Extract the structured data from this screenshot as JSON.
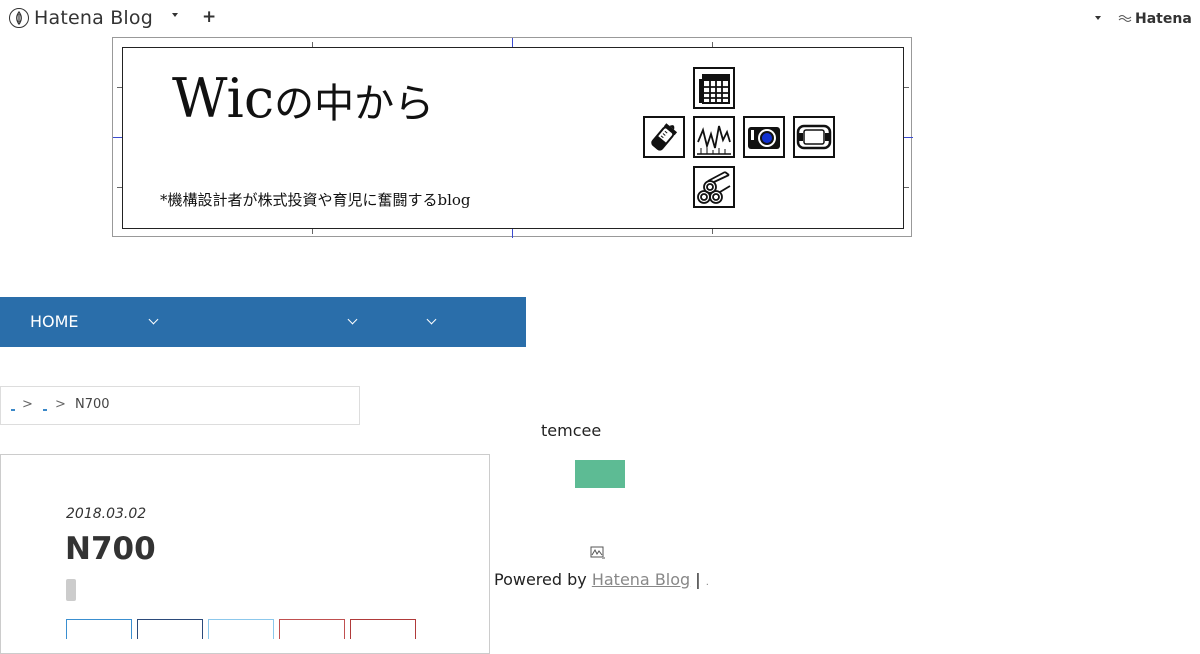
{
  "topbar": {
    "brand_label": "Hatena Blog",
    "plus_label": "+",
    "right_brand_label": "Hatena"
  },
  "banner": {
    "title_latin": "Wic",
    "title_japanese": "の中から",
    "subtitle": "*機構設計者が株式投資や育児に奮闘するblog",
    "icons": [
      "calendar-grid-icon",
      "baby-bottle-icon",
      "stock-chart-icon",
      "camera-icon",
      "game-console-icon",
      "logs-icon"
    ]
  },
  "nav": {
    "home_label": "HOME"
  },
  "breadcrumb": {
    "separator": ">",
    "current": "N700"
  },
  "article": {
    "date": "2018.03.02",
    "title": "N700"
  },
  "sidebar": {
    "author_name": "temcee"
  },
  "footer": {
    "powered_by": "Powered by",
    "hatena_blog_link": "Hatena Blog",
    "pipe": "|"
  },
  "colors": {
    "nav_background": "#2a6eaa",
    "follow_button": "#5dbb94",
    "link": "#888888"
  }
}
